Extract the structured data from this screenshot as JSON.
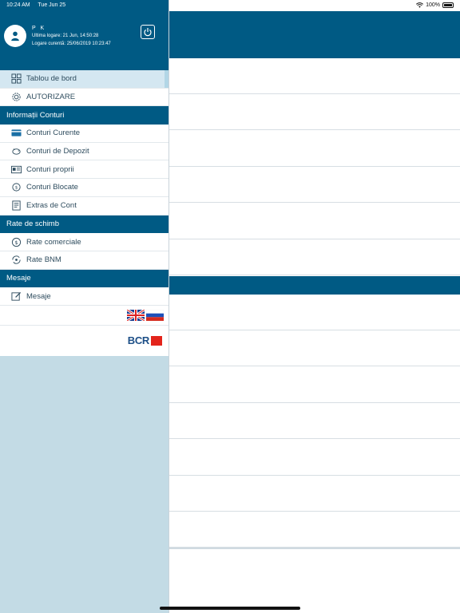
{
  "status_bar": {
    "time": "10:24 AM",
    "date": "Tue Jun 25",
    "battery": "100%"
  },
  "profile": {
    "name": "P K",
    "last_login": "Ultima logare: 21 Jun, 14:50:28",
    "current_login": "Logare curentă: 25/06/2019 10:23:47",
    "avatar_icon": "user-icon",
    "power_icon": "power-icon"
  },
  "menu": {
    "dashboard": {
      "label": "Tablou de bord",
      "icon": "grid-icon"
    },
    "authorization": {
      "label": "AUTORIZARE",
      "icon": "gear-icon"
    },
    "accounts_section": "Informații Conturi",
    "accounts": [
      {
        "label": "Conturi Curente",
        "icon": "card-icon"
      },
      {
        "label": "Conturi de Depozit",
        "icon": "piggy-bank-icon"
      },
      {
        "label": "Conturi proprii",
        "icon": "id-card-icon"
      },
      {
        "label": "Conturi Blocate",
        "icon": "lock-coin-icon"
      },
      {
        "label": "Extras de Cont",
        "icon": "statement-icon"
      }
    ],
    "rates_section": "Rate de schimb",
    "rates": [
      {
        "label": "Rate comerciale",
        "icon": "exchange-icon"
      },
      {
        "label": "Rate BNM",
        "icon": "exchange-bnm-icon"
      }
    ],
    "messages_section": "Mesaje",
    "messages": [
      {
        "label": "Mesaje",
        "icon": "edit-icon"
      }
    ]
  },
  "languages": [
    "English",
    "Russian"
  ],
  "brand": {
    "logo_text": "BCR",
    "accent": "#e3241b",
    "primary": "#005a84"
  }
}
